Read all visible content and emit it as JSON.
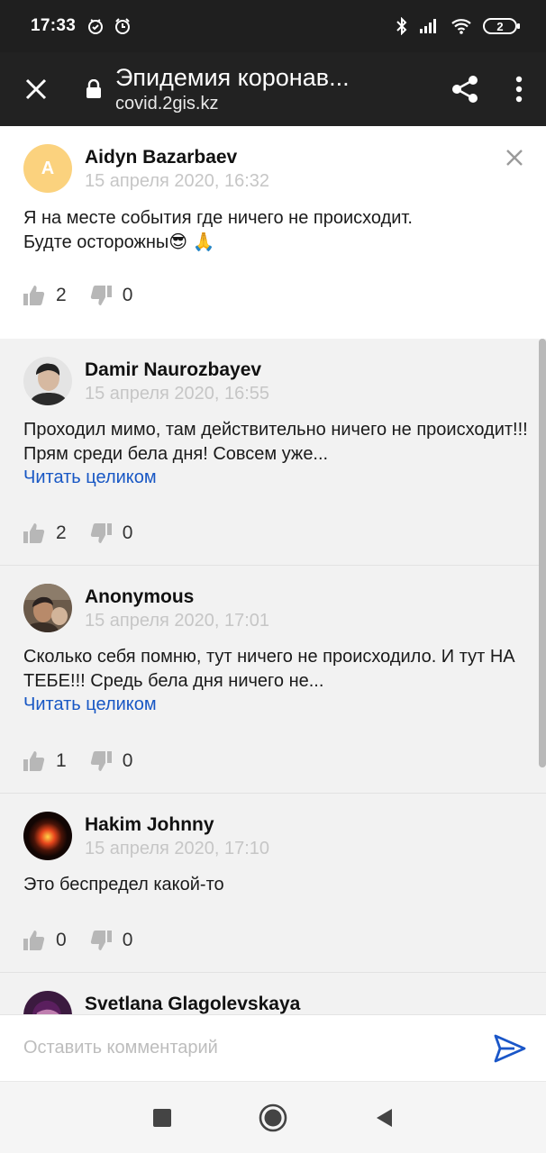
{
  "status_bar": {
    "time": "17:33",
    "battery": "2"
  },
  "app_bar": {
    "title": "Эпидемия коронав...",
    "url": "covid.2gis.kz"
  },
  "comments": [
    {
      "author": "Aidyn Bazarbaev",
      "avatar_letter": "A",
      "date": "15 апреля 2020, 16:32",
      "text_line1": "Я на месте события где ничего не происходит.",
      "text_line2": "Будте осторожны😎 🙏",
      "likes": "2",
      "dislikes": "0"
    },
    {
      "author": "Damir Naurozbayev",
      "date": "15 апреля 2020, 16:55",
      "text": "Проходил мимо, там действительно ничего не происходит!!! Прям среди бела дня! Совсем уже...",
      "more": "Читать целиком",
      "likes": "2",
      "dislikes": "0"
    },
    {
      "author": "Anonymous",
      "date": "15 апреля 2020, 17:01",
      "text": "Сколько себя помню, тут ничего не происходило. И тут НА ТЕБЕ!!! Средь бела дня ничего не...",
      "more": "Читать целиком",
      "likes": "1",
      "dislikes": "0"
    },
    {
      "author": "Hakim Johnny",
      "date": "15 апреля 2020, 17:10",
      "text": "Это беспредел какой-то",
      "likes": "0",
      "dislikes": "0"
    },
    {
      "author": "Svetlana Glagolevskaya"
    }
  ],
  "input": {
    "placeholder": "Оставить комментарий"
  },
  "colors": {
    "link": "#1857c4",
    "appbar": "#222222",
    "send": "#1a56c8"
  }
}
